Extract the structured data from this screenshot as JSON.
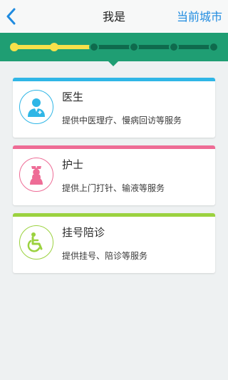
{
  "header": {
    "title": "我是",
    "right_action": "当前城市"
  },
  "progress": {
    "total_steps": 6,
    "completed_steps": 2,
    "completed_color": "#f7e14a",
    "track_color": "#0f6a4d",
    "band_color": "#1f9e73"
  },
  "roles": [
    {
      "title": "医生",
      "description": "提供中医理疗、慢病回访等服务",
      "accent": "#2fb6e6",
      "icon": "doctor-icon"
    },
    {
      "title": "护士",
      "description": "提供上门打针、输液等服务",
      "accent": "#ee6c96",
      "icon": "nurse-icon"
    },
    {
      "title": "挂号陪诊",
      "description": "提供挂号、陪诊等服务",
      "accent": "#9bd23f",
      "icon": "wheelchair-icon"
    }
  ]
}
